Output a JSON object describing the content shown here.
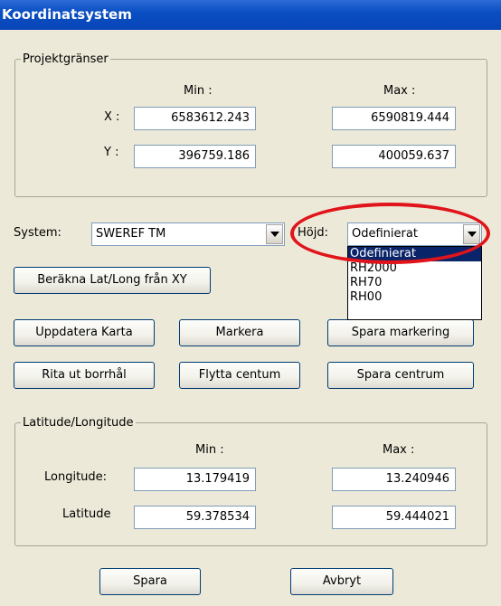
{
  "window": {
    "title": "Koordinatsystem"
  },
  "project_bounds": {
    "legend": "Projektgränser",
    "min_header": "Min :",
    "max_header": "Max :",
    "x_label": "X :",
    "y_label": "Y :",
    "x_min": "6583612.243",
    "x_max": "6590819.444",
    "y_min": "396759.186",
    "y_max": "400059.637"
  },
  "system": {
    "label": "System:",
    "value": "SWEREF TM"
  },
  "height": {
    "label": "Höjd:",
    "value": "Odefinierat",
    "options": [
      "Odefinierat",
      "RH2000",
      "RH70",
      "RH00"
    ],
    "selected_index": 0
  },
  "buttons": {
    "calc_latlong": "Beräkna Lat/Long från XY",
    "update_map": "Uppdatera Karta",
    "mark": "Markera",
    "save_marking": "Spara markering",
    "draw_boreholes": "Rita ut borrhål",
    "move_center": "Flytta centum",
    "save_center": "Spara centrum",
    "save": "Spara",
    "cancel": "Avbryt"
  },
  "latlong": {
    "legend": "Latitude/Longitude",
    "min_header": "Min :",
    "max_header": "Max :",
    "lon_label": "Longitude:",
    "lat_label": "Latitude",
    "lon_min": "13.179419",
    "lon_max": "13.240946",
    "lat_min": "59.378534",
    "lat_max": "59.444021"
  },
  "colors": {
    "highlight_ring": "#e0141a",
    "titlebar": "#0a4fc2",
    "selection": "#0a246a"
  }
}
